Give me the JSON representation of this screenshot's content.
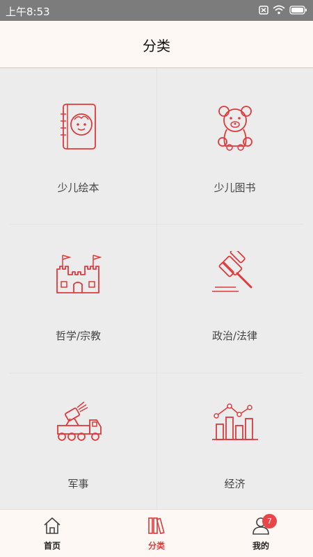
{
  "status_bar": {
    "time": "上午8:53"
  },
  "header": {
    "title": "分类"
  },
  "categories": [
    {
      "label": "少儿绘本",
      "icon": "baby-book-icon"
    },
    {
      "label": "少儿图书",
      "icon": "teddy-bear-icon"
    },
    {
      "label": "哲学/宗教",
      "icon": "castle-icon"
    },
    {
      "label": "政治/法律",
      "icon": "gavel-icon"
    },
    {
      "label": "军事",
      "icon": "military-truck-icon"
    },
    {
      "label": "经济",
      "icon": "bar-chart-icon"
    }
  ],
  "tabs": [
    {
      "label": "首页",
      "icon": "home-icon"
    },
    {
      "label": "分类",
      "icon": "books-icon"
    },
    {
      "label": "我的",
      "icon": "user-icon"
    }
  ],
  "badge": {
    "count": "7"
  },
  "colors": {
    "accent": "#e0393a",
    "header_bg": "#fdf8f3",
    "grid_bg": "#ececec"
  }
}
